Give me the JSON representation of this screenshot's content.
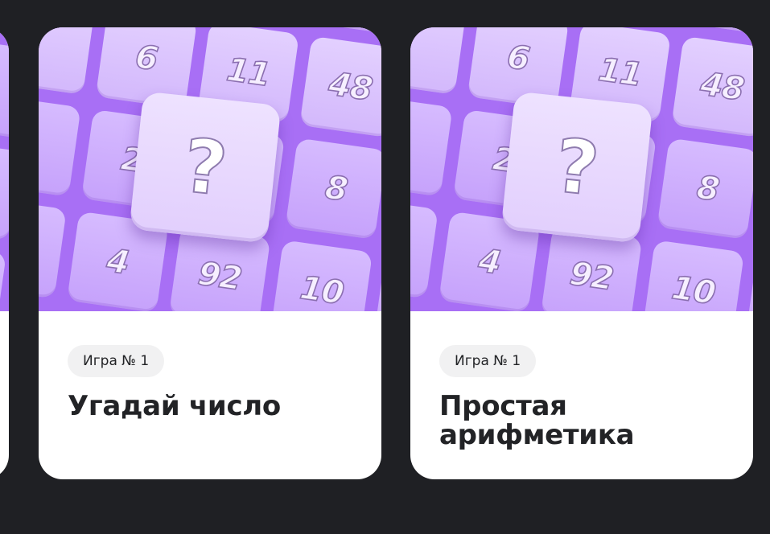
{
  "cards": [
    {
      "badge": "Игра № 1",
      "title": "Угадай число",
      "image": {
        "numbers": [
          "6",
          "11",
          "48",
          "2",
          "8",
          "4",
          "92",
          "10"
        ],
        "center_symbol": "?"
      }
    },
    {
      "badge": "Игра № 1",
      "title": "Простая арифметика",
      "image": {
        "numbers": [
          "6",
          "11",
          "48",
          "2",
          "8",
          "4",
          "92",
          "10"
        ],
        "center_symbol": "?"
      }
    }
  ],
  "colors": {
    "background": "#1f2024",
    "card": "#ffffff",
    "cover": "#a86ff5",
    "tile": "#d6bbff",
    "text": "#222326",
    "badge": "#f1f1f2"
  }
}
